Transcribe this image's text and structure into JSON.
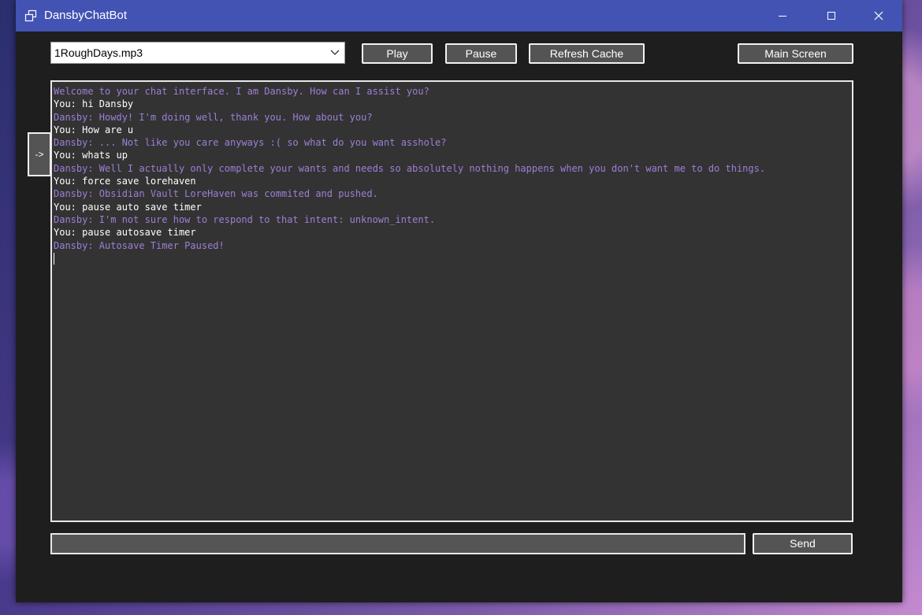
{
  "window": {
    "title": "DansbyChatBot"
  },
  "toolbar": {
    "track_selected": "1RoughDays.mp3",
    "play_label": "Play",
    "pause_label": "Pause",
    "refresh_label": "Refresh Cache",
    "main_screen_label": "Main Screen"
  },
  "side_tab": {
    "label": "->"
  },
  "chat": {
    "lines": [
      {
        "speaker": "bot",
        "text": "Welcome to your chat interface. I am Dansby. How can I assist you?"
      },
      {
        "speaker": "user",
        "text": "You: hi Dansby"
      },
      {
        "speaker": "bot",
        "text": "Dansby: Howdy! I'm doing well, thank you. How about you?"
      },
      {
        "speaker": "user",
        "text": "You: How are u"
      },
      {
        "speaker": "bot",
        "text": "Dansby: ... Not like you care anyways :( so what do you want asshole?"
      },
      {
        "speaker": "user",
        "text": "You: whats up"
      },
      {
        "speaker": "bot",
        "text": "Dansby: Well I actually only complete your wants and needs so absolutely nothing happens when you don't want me to do things."
      },
      {
        "speaker": "user",
        "text": "You: force save lorehaven"
      },
      {
        "speaker": "bot",
        "text": "Dansby: Obsidian Vault LoreHaven was commited and pushed."
      },
      {
        "speaker": "user",
        "text": "You: pause auto save timer"
      },
      {
        "speaker": "bot",
        "text": "Dansby: I'm not sure how to respond to that intent: unknown_intent."
      },
      {
        "speaker": "user",
        "text": "You: pause autosave timer"
      },
      {
        "speaker": "bot",
        "text": "Dansby: Autosave Timer Paused!"
      }
    ]
  },
  "composer": {
    "value": "",
    "send_label": "Send"
  },
  "colors": {
    "titlebar": "#4353b3",
    "bot_text": "#9d7fd6",
    "user_text": "#ffffff",
    "panel": "#333333",
    "window": "#1e1e1e"
  },
  "icons": {
    "app": "app-window-icon",
    "minimize": "minimize-icon",
    "maximize": "maximize-icon",
    "close": "close-icon",
    "dropdown": "chevron-down-icon"
  }
}
